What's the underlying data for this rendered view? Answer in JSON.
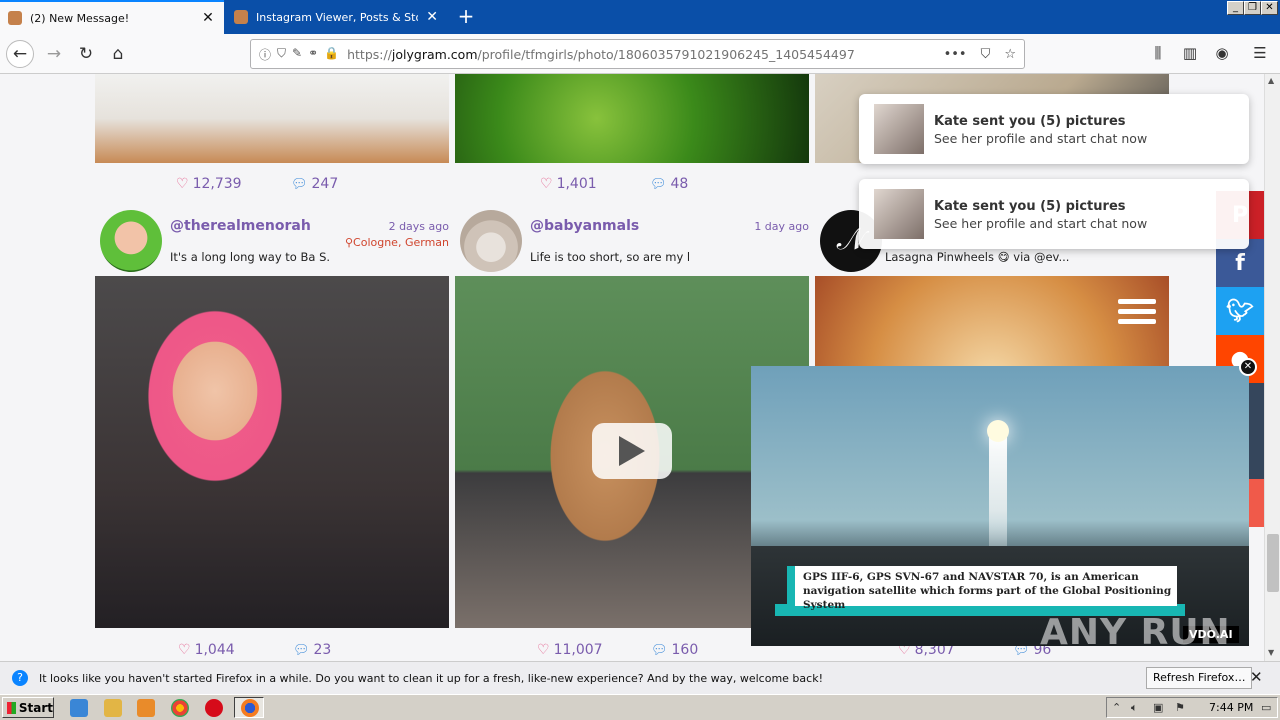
{
  "browser": {
    "tabs": [
      {
        "title": "(2) New Message!",
        "active": true
      },
      {
        "title": "Instagram Viewer, Posts & Story",
        "active": false
      }
    ],
    "new_tab": "+",
    "url_prefix": "https://",
    "url_host": "jolygram.com",
    "url_path": "/profile/tfmgirls/photo/1806035791021906245_1405454497",
    "url_more": "•••"
  },
  "top_row_stats": [
    {
      "likes": "12,739",
      "comments": "247"
    },
    {
      "likes": "1,401",
      "comments": "48"
    }
  ],
  "cards": [
    {
      "username": "@therealmenorah",
      "ago": "2 days ago",
      "location": "Cologne, German",
      "caption": "It's a long long way to Ba S...",
      "likes": "1,044",
      "comments": "23"
    },
    {
      "username": "@babyanmals",
      "ago": "1 day ago",
      "location": "",
      "caption": "Life is too short, so are my l...",
      "likes": "11,007",
      "comments": "160"
    },
    {
      "username": "",
      "ago": "",
      "location": "",
      "caption": "Lasagna Pinwheels 😋 via @ev...",
      "likes": "8,307",
      "comments": "96"
    }
  ],
  "notifications": [
    {
      "title": "Kate sent you (5) pictures",
      "subtitle": "See her profile and start chat now"
    },
    {
      "title": "Kate sent you (5) pictures",
      "subtitle": "See her profile and start chat now"
    }
  ],
  "share_colors": {
    "pinterest": "#cb2027",
    "facebook": "#3b5998",
    "twitter": "#1da1f2",
    "reddit": "#ff4500",
    "tumblr": "#35465c",
    "other": "#f05a4a"
  },
  "video_ad": {
    "caption": "GPS IIF-6, GPS SVN-67 and NAVSTAR 70, is an American navigation satellite which forms part of the Global Positioning System",
    "brand": "VDO.AI"
  },
  "watermark": "ANY RUN",
  "infobar": {
    "message": "It looks like you haven't started Firefox in a while. Do you want to clean it up for a fresh, like-new experience? And by the way, welcome back!",
    "button": "Refresh Firefox…"
  },
  "taskbar": {
    "start": "Start",
    "clock": "7:44 PM"
  }
}
